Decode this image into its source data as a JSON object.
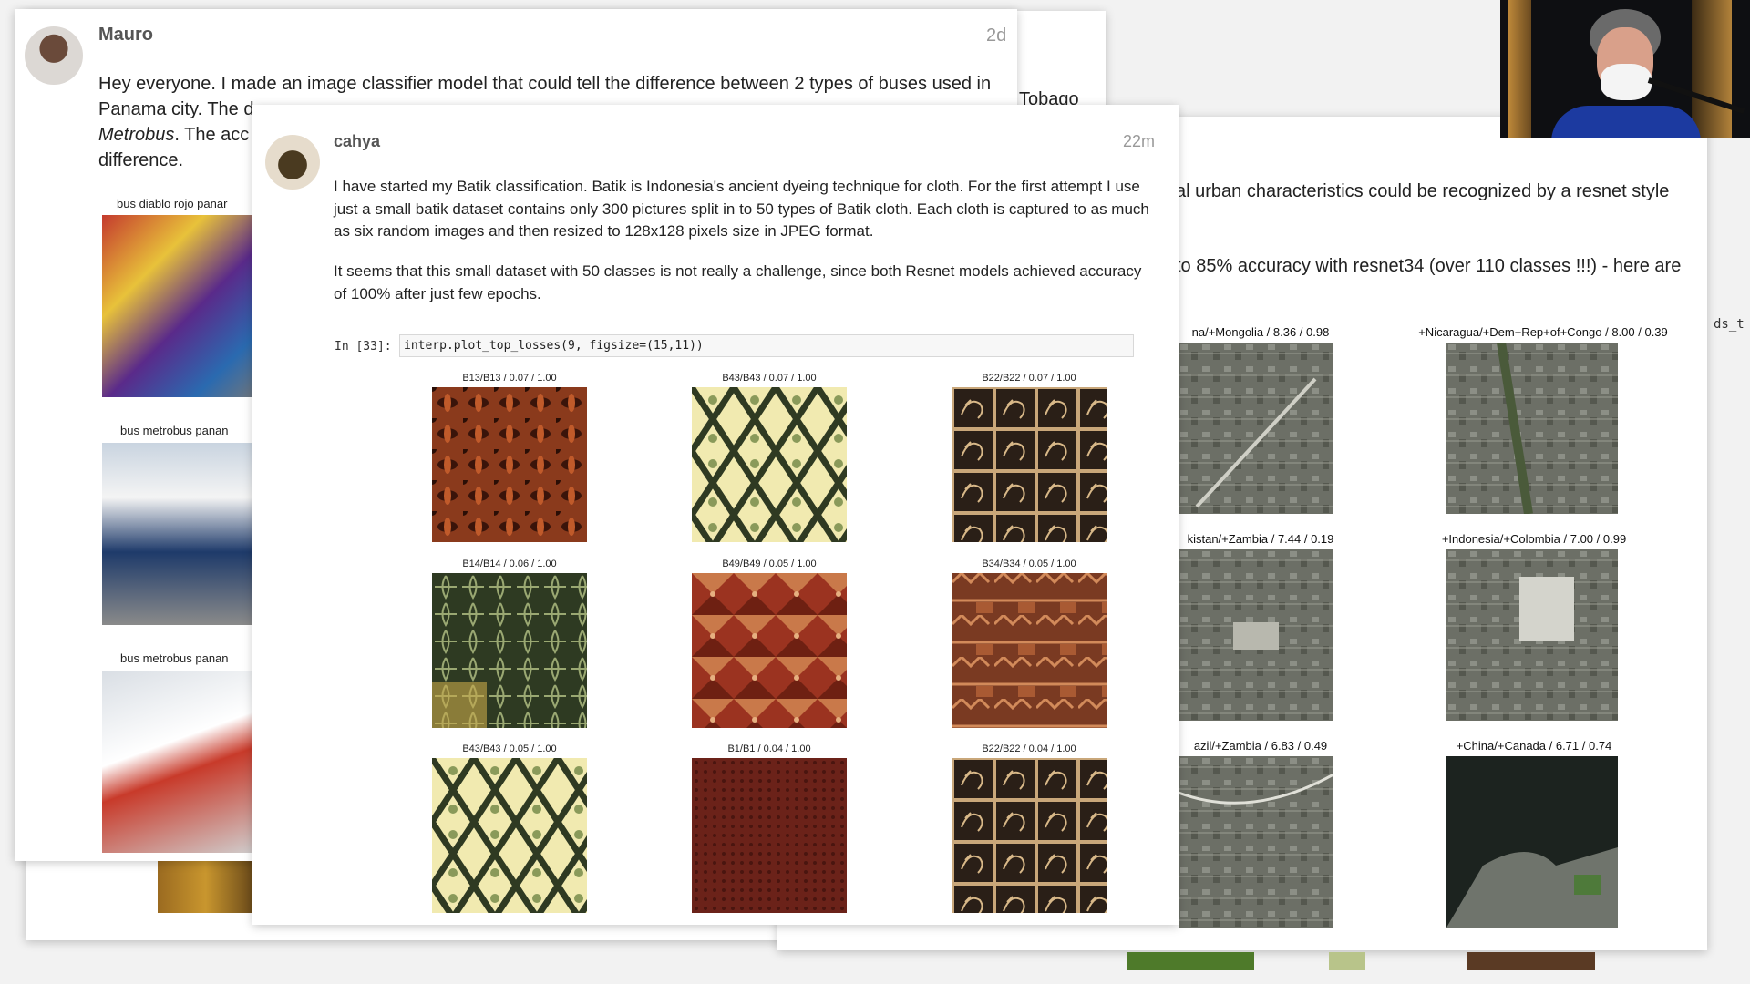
{
  "background_card": {
    "text_fragment": "Tobago",
    "code_fragment": "ds_t"
  },
  "mauro_post": {
    "author": "Mauro",
    "time": "2d",
    "line1": "Hey everyone. I made an image classifier model that could tell the difference between 2 types of buses used in",
    "line2_start": "Panama city. The ",
    "line2_cut": "d",
    "line3_italic": "Metrobus",
    "line3_rest": ". The acc",
    "line4": "difference.",
    "captions": [
      "bus diablo rojo panar",
      "bus metrobus panan",
      "bus metrobus panan"
    ]
  },
  "cahya_post": {
    "author": "cahya",
    "time": "22m",
    "paragraph1": "I have started my Batik classification. Batik is Indonesia's ancient dyeing technique for cloth. For the first attempt I use just a small batik dataset contains only 300 pictures split in to 50 types of Batik cloth. Each cloth is captured to as much as six random images and then resized to 128x128 pixels size in JPEG format.",
    "paragraph2": "It seems that this small dataset with 50 classes is not really a challenge, since both Resnet models achieved accuracy of 100% after just few epochs.",
    "code_prompt": "In [33]:",
    "code": "interp.plot_top_losses(9, figsize=(15,11))",
    "tiles": [
      {
        "label": "B13/B13 / 0.07 / 1.00",
        "pattern": "rust-floral"
      },
      {
        "label": "B43/B43 / 0.07 / 1.00",
        "pattern": "cream-zigzag"
      },
      {
        "label": "B22/B22 / 0.07 / 1.00",
        "pattern": "brown-animal-grid"
      },
      {
        "label": "B14/B14 / 0.06 / 1.00",
        "pattern": "green-leaf"
      },
      {
        "label": "B49/B49 / 0.05 / 1.00",
        "pattern": "red-geometric"
      },
      {
        "label": "B34/B34 / 0.05 / 1.00",
        "pattern": "brown-patchwork"
      },
      {
        "label": "B43/B43 / 0.05 / 1.00",
        "pattern": "cream-zigzag"
      },
      {
        "label": "B1/B1 / 0.04 / 1.00",
        "pattern": "maroon-dots"
      },
      {
        "label": "B22/B22 / 0.04 / 1.00",
        "pattern": "brown-animal-grid"
      }
    ]
  },
  "urban_post": {
    "line1": "al urban characteristics could be recognized by a resnet style",
    "line2": "to 85% accuracy with resnet34 (over 110 classes !!!) - here are",
    "captions": [
      "na/+Mongolia / 8.36 / 0.98",
      "+Nicaragua/+Dem+Rep+of+Congo / 8.00 / 0.39",
      "kistan/+Zambia / 7.44 / 0.19",
      "+Indonesia/+Colombia / 7.00 / 0.99",
      "azil/+Zambia / 6.83 / 0.49",
      "+China/+Canada / 6.71 / 0.74"
    ]
  },
  "video": {
    "subject": "presenter-webcam"
  }
}
